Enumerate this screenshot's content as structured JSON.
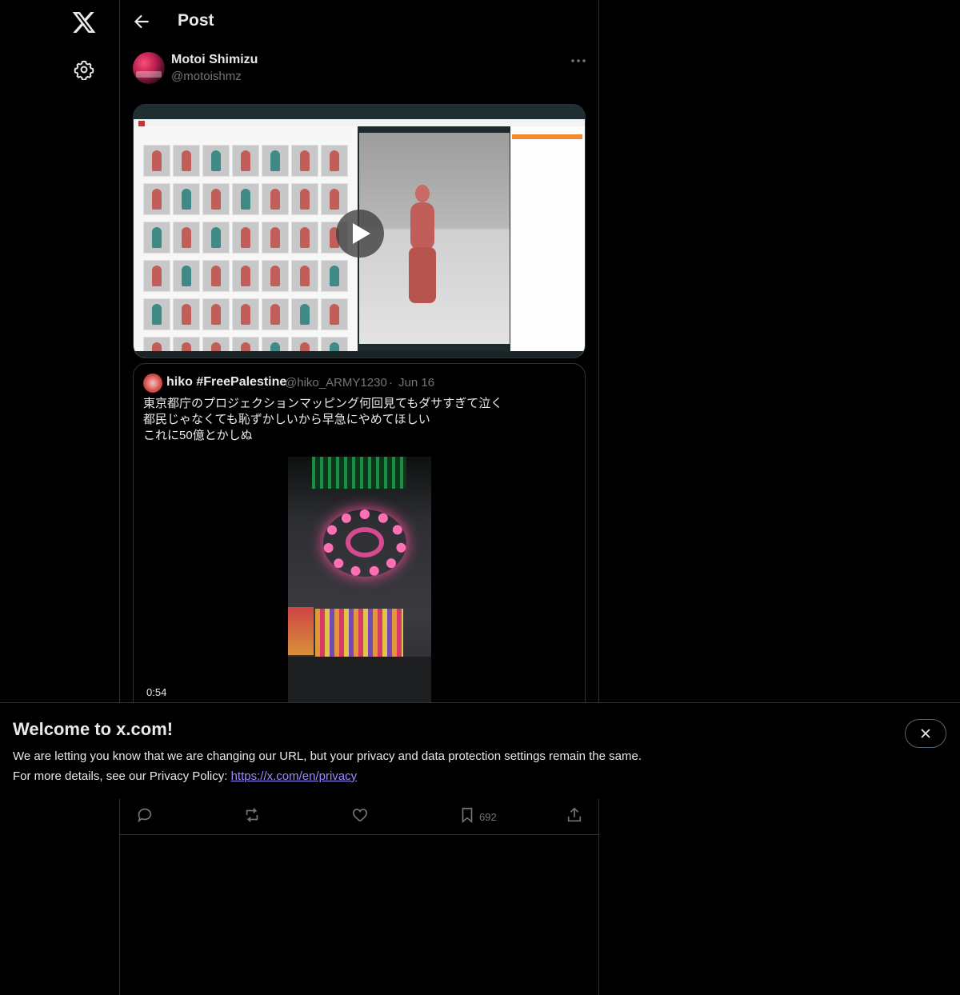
{
  "header": {
    "title": "Post"
  },
  "post": {
    "author_name": "Motoi Shimizu",
    "author_handle": "@motoishmz"
  },
  "quote": {
    "author_name": "hiko #FreePalestine",
    "author_handle": "@hiko_ARMY1230",
    "separator": "·",
    "date": "Jun 16",
    "text_lines": [
      "東京都庁のプロジェクションマッピング何回見てもダサすぎて泣く",
      "都民じゃなくても恥ずかしいから早急にやめてほしい",
      "これに50億とかしぬ"
    ],
    "video_duration": "0:54"
  },
  "banner": {
    "title": "Welcome to x.com!",
    "line1": "We are letting you know that we are changing our URL, but your privacy and data protection settings remain the same.",
    "line2_prefix": "For more details, see our Privacy Policy: ",
    "link": "https://x.com/en/privacy"
  },
  "actions": {
    "bookmark_count": "692"
  },
  "icons": {
    "logo": "x-logo-icon",
    "settings": "gear-icon",
    "back": "arrow-left-icon",
    "more": "more-dots-icon",
    "play": "play-icon",
    "close": "close-icon",
    "reply": "reply-icon",
    "repost": "repost-icon",
    "like": "heart-icon",
    "bookmark": "bookmark-icon",
    "share": "share-icon"
  },
  "colors": {
    "background": "#000000",
    "text": "#e7e9ea",
    "secondary_text": "#71767b",
    "border": "#2f3336",
    "link": "#9a8bff"
  }
}
